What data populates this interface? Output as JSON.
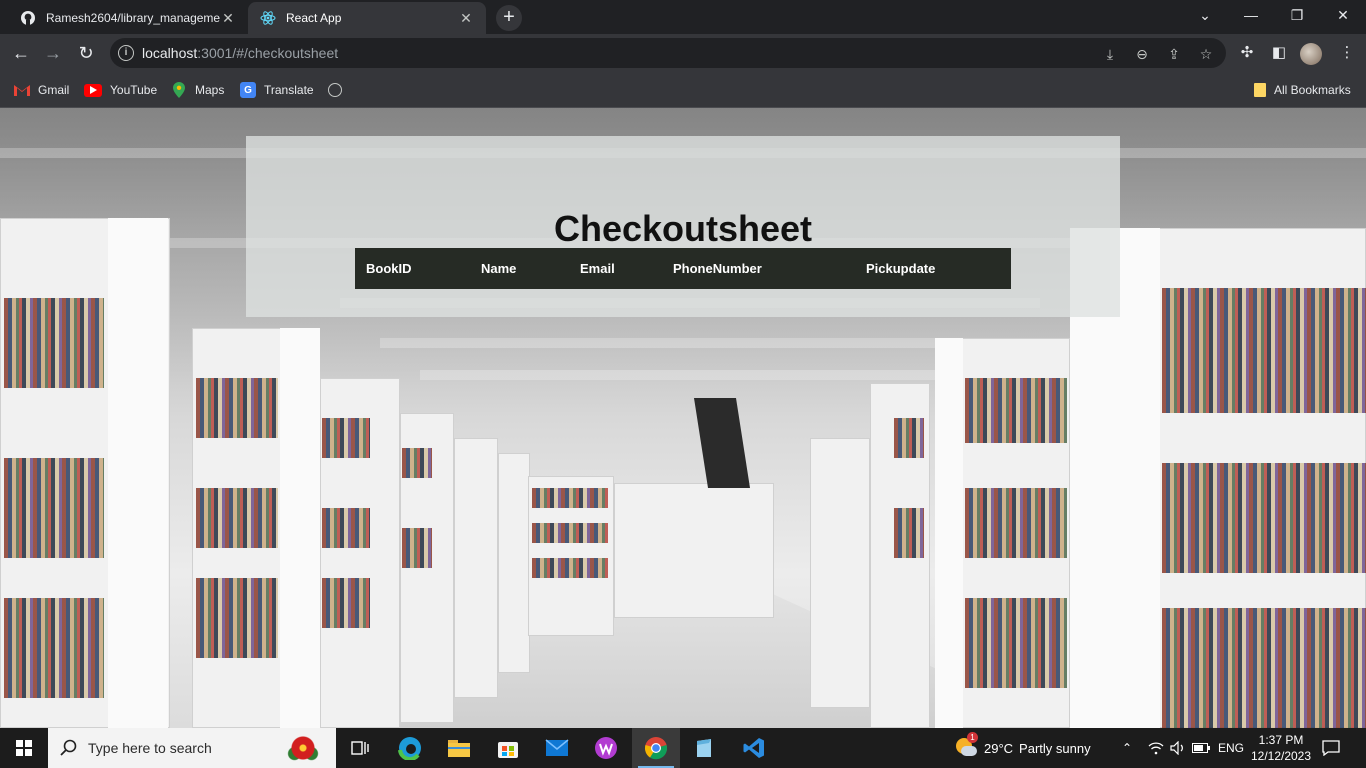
{
  "browser": {
    "tabs": [
      {
        "title": "Ramesh2604/library_manageme",
        "icon": "github-icon"
      },
      {
        "title": "React App",
        "icon": "react-icon"
      }
    ],
    "new_tab_label": "+",
    "url_host": "localhost",
    "url_rest": ":3001/#/checkoutsheet",
    "bookmarks": [
      {
        "label": "Gmail",
        "icon": "gmail-icon"
      },
      {
        "label": "YouTube",
        "icon": "youtube-icon"
      },
      {
        "label": "Maps",
        "icon": "maps-icon"
      },
      {
        "label": "Translate",
        "icon": "translate-icon"
      }
    ],
    "all_bookmarks_label": "All Bookmarks"
  },
  "page": {
    "heading": "Checkoutsheet",
    "table": {
      "columns": [
        "BookID",
        "Name",
        "Email",
        "PhoneNumber",
        "Pickupdate"
      ],
      "rows": []
    }
  },
  "taskbar": {
    "search_placeholder": "Type here to search",
    "weather": {
      "temp": "29°C",
      "condition": "Partly sunny",
      "badge": "1"
    },
    "language": "ENG",
    "time": "1:37 PM",
    "date": "12/12/2023",
    "pinned_apps": [
      "task-view-icon",
      "edge-icon",
      "file-explorer-icon",
      "microsoft-store-icon",
      "mail-icon",
      "wps-office-icon",
      "chrome-icon",
      "notepad-icon",
      "vscode-icon"
    ]
  },
  "colors": {
    "table_header_bg": "#262b25",
    "panel_bg": "rgba(222,226,224,0.78)",
    "browser_frame": "#202124",
    "toolbar": "#35363a"
  }
}
